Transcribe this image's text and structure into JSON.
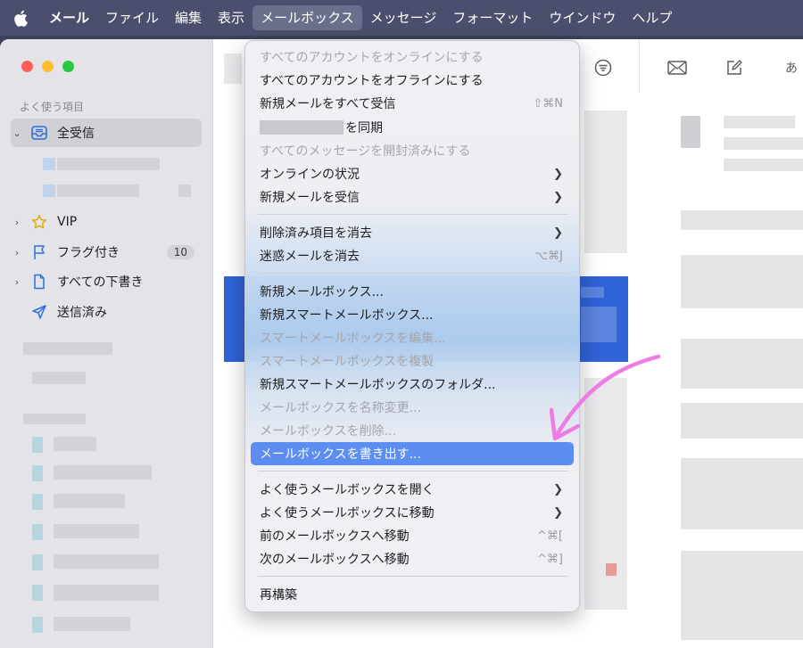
{
  "menubar": {
    "items": [
      "メール",
      "ファイル",
      "編集",
      "表示",
      "メールボックス",
      "メッセージ",
      "フォーマット",
      "ウインドウ",
      "ヘルプ"
    ],
    "active_index": 4
  },
  "sidebar": {
    "section_label": "よく使う項目",
    "items": [
      {
        "label": "全受信",
        "icon": "inbox-icon"
      },
      {
        "label": "VIP",
        "icon": "star-icon"
      },
      {
        "label": "フラグ付き",
        "icon": "flag-icon",
        "badge": "10"
      },
      {
        "label": "すべての下書き",
        "icon": "document-icon"
      },
      {
        "label": "送信済み",
        "icon": "paper-plane-icon"
      }
    ]
  },
  "toolbar": {
    "filter_icon": "filter-icon",
    "compose_icons": [
      "envelope-icon",
      "compose-icon"
    ],
    "ime_label": "あ"
  },
  "mailbox_menu": {
    "items": [
      {
        "label": "すべてのアカウントをオンラインにする",
        "state": "disabled"
      },
      {
        "label": "すべてのアカウントをオフラインにする",
        "state": "enabled"
      },
      {
        "label": "新規メールをすべて受信",
        "shortcut": "⇧⌘N",
        "state": "enabled"
      },
      {
        "label": "を同期",
        "state": "enabled",
        "redacted_prefix": true
      },
      {
        "label": "すべてのメッセージを開封済みにする",
        "state": "disabled"
      },
      {
        "label": "オンラインの状況",
        "submenu": true,
        "state": "enabled"
      },
      {
        "label": "新規メールを受信",
        "submenu": true,
        "state": "enabled"
      },
      {
        "label": "削除済み項目を消去",
        "submenu": true,
        "state": "enabled"
      },
      {
        "label": "迷惑メールを消去",
        "shortcut": "⌥⌘J",
        "state": "enabled"
      },
      {
        "label": "新規メールボックス...",
        "state": "enabled"
      },
      {
        "label": "新規スマートメールボックス...",
        "state": "enabled"
      },
      {
        "label": "スマートメールボックスを編集...",
        "state": "disabled"
      },
      {
        "label": "スマートメールボックスを複製",
        "state": "disabled"
      },
      {
        "label": "新規スマートメールボックスのフォルダ...",
        "state": "enabled"
      },
      {
        "label": "メールボックスを名称変更...",
        "state": "disabled"
      },
      {
        "label": "メールボックスを削除...",
        "state": "disabled"
      },
      {
        "label": "メールボックスを書き出す...",
        "state": "highlighted"
      },
      {
        "label": "よく使うメールボックスを開く",
        "submenu": true,
        "state": "enabled"
      },
      {
        "label": "よく使うメールボックスに移動",
        "submenu": true,
        "state": "enabled"
      },
      {
        "label": "前のメールボックスへ移動",
        "shortcut": "^⌘[",
        "state": "enabled"
      },
      {
        "label": "次のメールボックスへ移動",
        "shortcut": "^⌘]",
        "state": "enabled"
      },
      {
        "label": "再構築",
        "state": "enabled"
      }
    ]
  },
  "colors": {
    "highlight": "#5b8ef0",
    "annotation_arrow": "#ee7ce4",
    "selection_row": "#2f63d6",
    "menubar": "#4b4f6d"
  }
}
